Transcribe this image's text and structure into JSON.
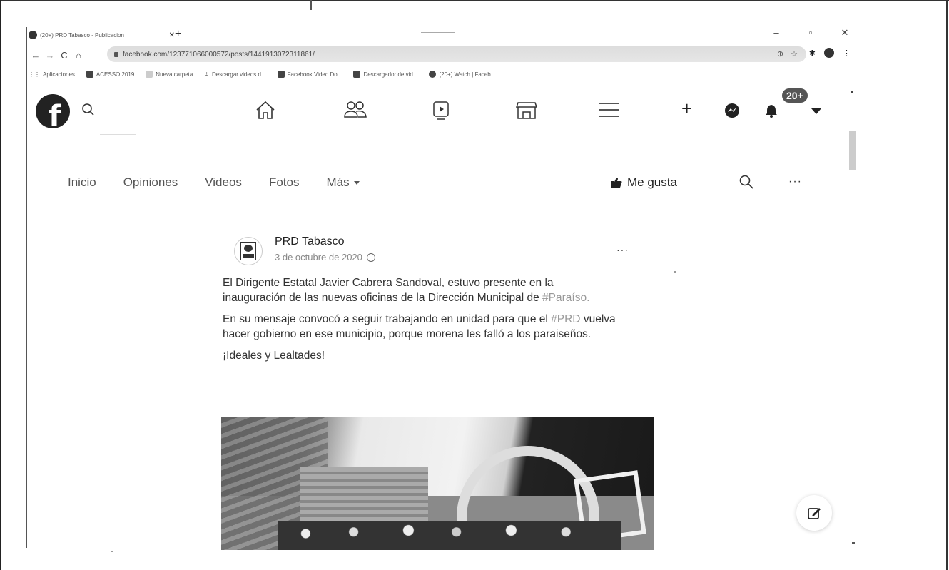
{
  "browser": {
    "tab_title": "(20+) PRD Tabasco - Publicacion",
    "tab_close": "✕",
    "new_tab": "+",
    "url": "facebook.com/123771066000572/posts/1441913072311861/",
    "window_controls": [
      "–",
      "▫",
      "✕"
    ],
    "bookmarks": [
      {
        "label": "Aplicaciones",
        "icon": "apps-grid-icon"
      },
      {
        "label": "ACESSO 2019",
        "icon": "bookmark-dark-icon"
      },
      {
        "label": "Nueva carpeta",
        "icon": "folder-icon"
      },
      {
        "label": "Descargar videos d...",
        "icon": "download-icon"
      },
      {
        "label": "Facebook Video Do...",
        "icon": "bookmark-dark-icon"
      },
      {
        "label": "Descargador de vid...",
        "icon": "bookmark-dark-icon"
      },
      {
        "label": "(20+) Watch | Faceb...",
        "icon": "facebook-icon"
      }
    ]
  },
  "facebook": {
    "logo_letter": "f",
    "notification_badge": "20+"
  },
  "page_nav": {
    "tabs": [
      "Inicio",
      "Opiniones",
      "Videos",
      "Fotos",
      "Más"
    ],
    "like_label": "Me gusta",
    "more": "···"
  },
  "post": {
    "author": "PRD Tabasco",
    "date": "3 de octubre de 2020",
    "more": "···",
    "paragraph1_text": "El Dirigente Estatal Javier Cabrera Sandoval, estuvo presente en la inauguración de las nuevas oficinas de la Dirección Municipal de ",
    "paragraph1_hashtag": "#Paraíso.",
    "paragraph2_hashtag": "#PRD",
    "paragraph2_pre": "En su mensaje convocó a seguir trabajando en unidad para que el ",
    "paragraph2_post": " vuelva hacer gobierno en ese municipio, porque morena les falló a los paraiseños.",
    "paragraph3": "¡Ideales y Lealtades!"
  }
}
